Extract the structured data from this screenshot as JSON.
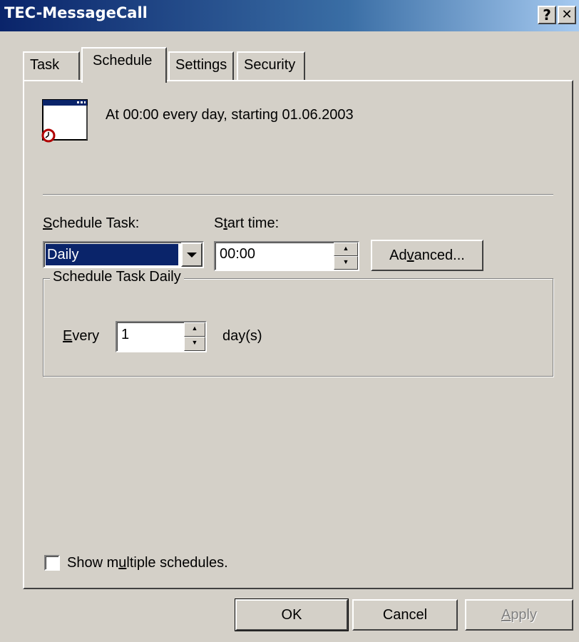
{
  "window": {
    "title": "TEC-MessageCall",
    "help_button": "?",
    "close_button": "✕"
  },
  "tabs": [
    {
      "label": "Task",
      "active": false
    },
    {
      "label": "Schedule",
      "active": true
    },
    {
      "label": "Settings",
      "active": false
    },
    {
      "label": "Security",
      "active": false
    }
  ],
  "summary": {
    "icon": "scheduled-task-clock-icon",
    "text": "At 00:00 every day, starting 01.06.2003"
  },
  "schedule_task": {
    "label_u": "S",
    "label_rest": "chedule Task:",
    "selected": "Daily"
  },
  "start_time": {
    "label_pre": "S",
    "label_u": "t",
    "label_rest": "art time:",
    "value": "00:00"
  },
  "advanced_button": {
    "pre": "Ad",
    "u": "v",
    "rest": "anced..."
  },
  "group": {
    "legend": "Schedule Task Daily",
    "every_u": "E",
    "every_rest": "very",
    "every_value": "1",
    "unit": "day(s)"
  },
  "show_multiple": {
    "pre": "Show m",
    "u": "u",
    "rest": "ltiple schedules.",
    "checked": false
  },
  "buttons": {
    "ok": "OK",
    "cancel": "Cancel",
    "apply_u": "A",
    "apply_rest": "pply"
  },
  "colors": {
    "titlebar_start": "#0a246a",
    "titlebar_end": "#a6caf0",
    "dialog_bg": "#d4d0c8",
    "selection": "#0a246a"
  }
}
